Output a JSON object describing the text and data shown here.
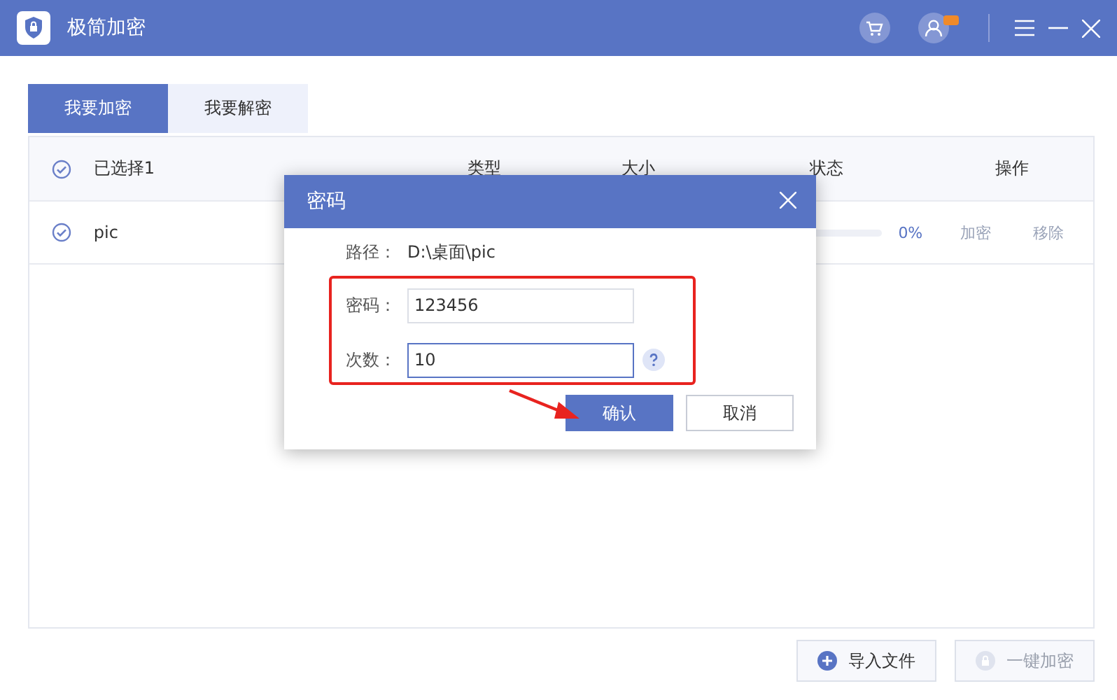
{
  "app": {
    "title": "极简加密"
  },
  "tabs": [
    {
      "label": "我要加密",
      "selected": true
    },
    {
      "label": "我要解密",
      "selected": false
    }
  ],
  "table": {
    "select_all": {
      "checked": true
    },
    "selected_count": "已选择1",
    "columns": [
      "类型",
      "大小",
      "状态",
      "操作"
    ],
    "rows": [
      {
        "name": "pic",
        "checked": true,
        "level": 0,
        "percent": "0%",
        "actions": [
          {
            "label": "加密",
            "disabled": true
          },
          {
            "label": "移除",
            "disabled": true
          }
        ]
      }
    ]
  },
  "buttons": [
    {
      "label": "导入文件",
      "disabled": false,
      "kind": "import"
    },
    {
      "label": "一键加密",
      "disabled": true,
      "kind": "lock"
    }
  ],
  "dialog": {
    "title": "密码",
    "path_label": "路径：",
    "path": "D:\\桌面\\pic",
    "fields": [
      {
        "label": "密码：",
        "value": "123456",
        "help": false,
        "focused": false
      },
      {
        "label": "次数：",
        "value": "10",
        "help": true,
        "focused": true
      }
    ],
    "buttons": [
      {
        "label": "确认",
        "primary": true
      },
      {
        "label": "取消",
        "primary": false
      }
    ]
  }
}
